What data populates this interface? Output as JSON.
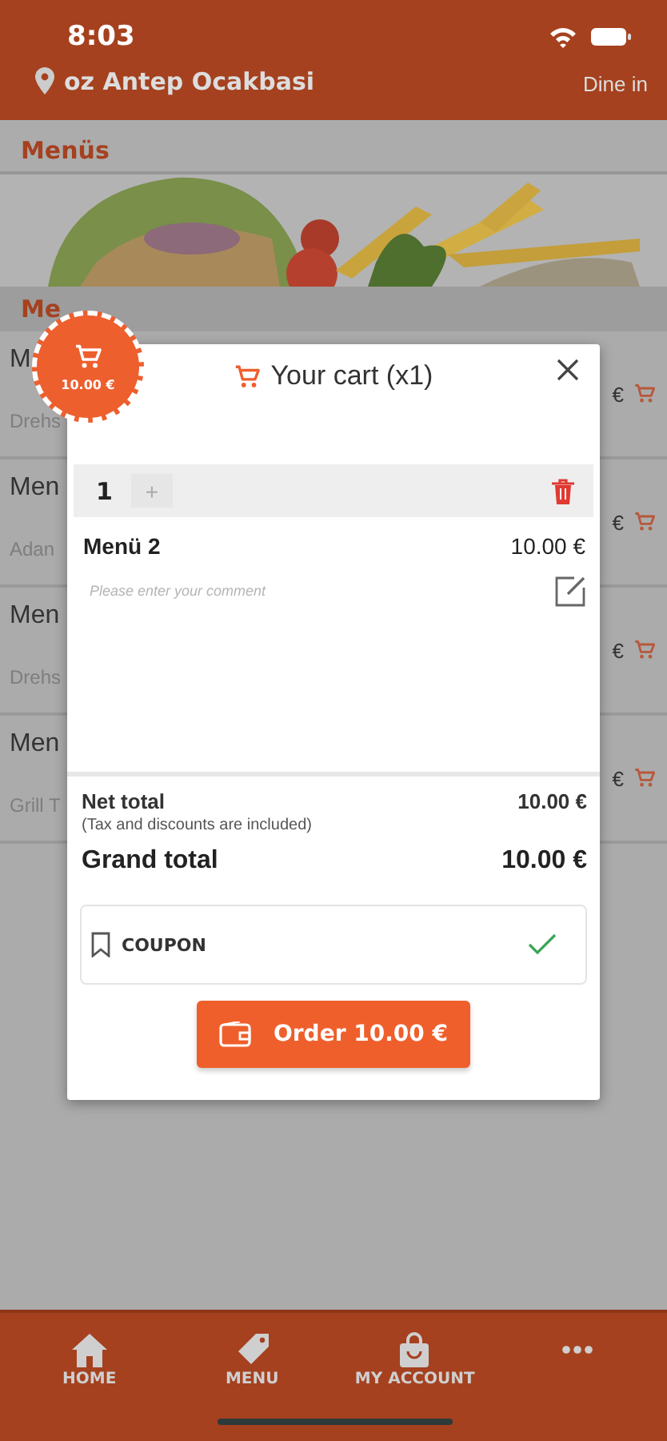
{
  "status_bar": {
    "time": "8:03"
  },
  "header": {
    "restaurant": "oz Antep Ocakbasi",
    "mode": "Dine in"
  },
  "section_title": "Menüs",
  "list_section_title": "Me",
  "items": [
    {
      "name": "M",
      "description": "Drehs",
      "price": "€"
    },
    {
      "name": "Men",
      "description": "Adan",
      "price": "€"
    },
    {
      "name": "Men",
      "description": "Drehs",
      "price": "€"
    },
    {
      "name": "Men",
      "description": "Grill T",
      "price": "€"
    }
  ],
  "cart": {
    "badge_amount": "10.00 €",
    "title": "Your cart (x1)",
    "lines": [
      {
        "quantity": "1",
        "plus": "+",
        "name": "Menü 2",
        "price": "10.00 €",
        "comment_placeholder": "Please enter your comment"
      }
    ],
    "net_total_label": "Net total",
    "net_total": "10.00 €",
    "tax_note": "(Tax and discounts are included)",
    "grand_total_label": "Grand total",
    "grand_total": "10.00 €",
    "coupon": {
      "label": "COUPON",
      "applied": true
    },
    "order_button": "Order 10.00 €"
  },
  "nav": [
    {
      "kind": "home",
      "label": "HOME"
    },
    {
      "kind": "tag",
      "label": "MENU"
    },
    {
      "kind": "bag",
      "label": "MY ACCOUNT"
    },
    {
      "kind": "more"
    }
  ]
}
